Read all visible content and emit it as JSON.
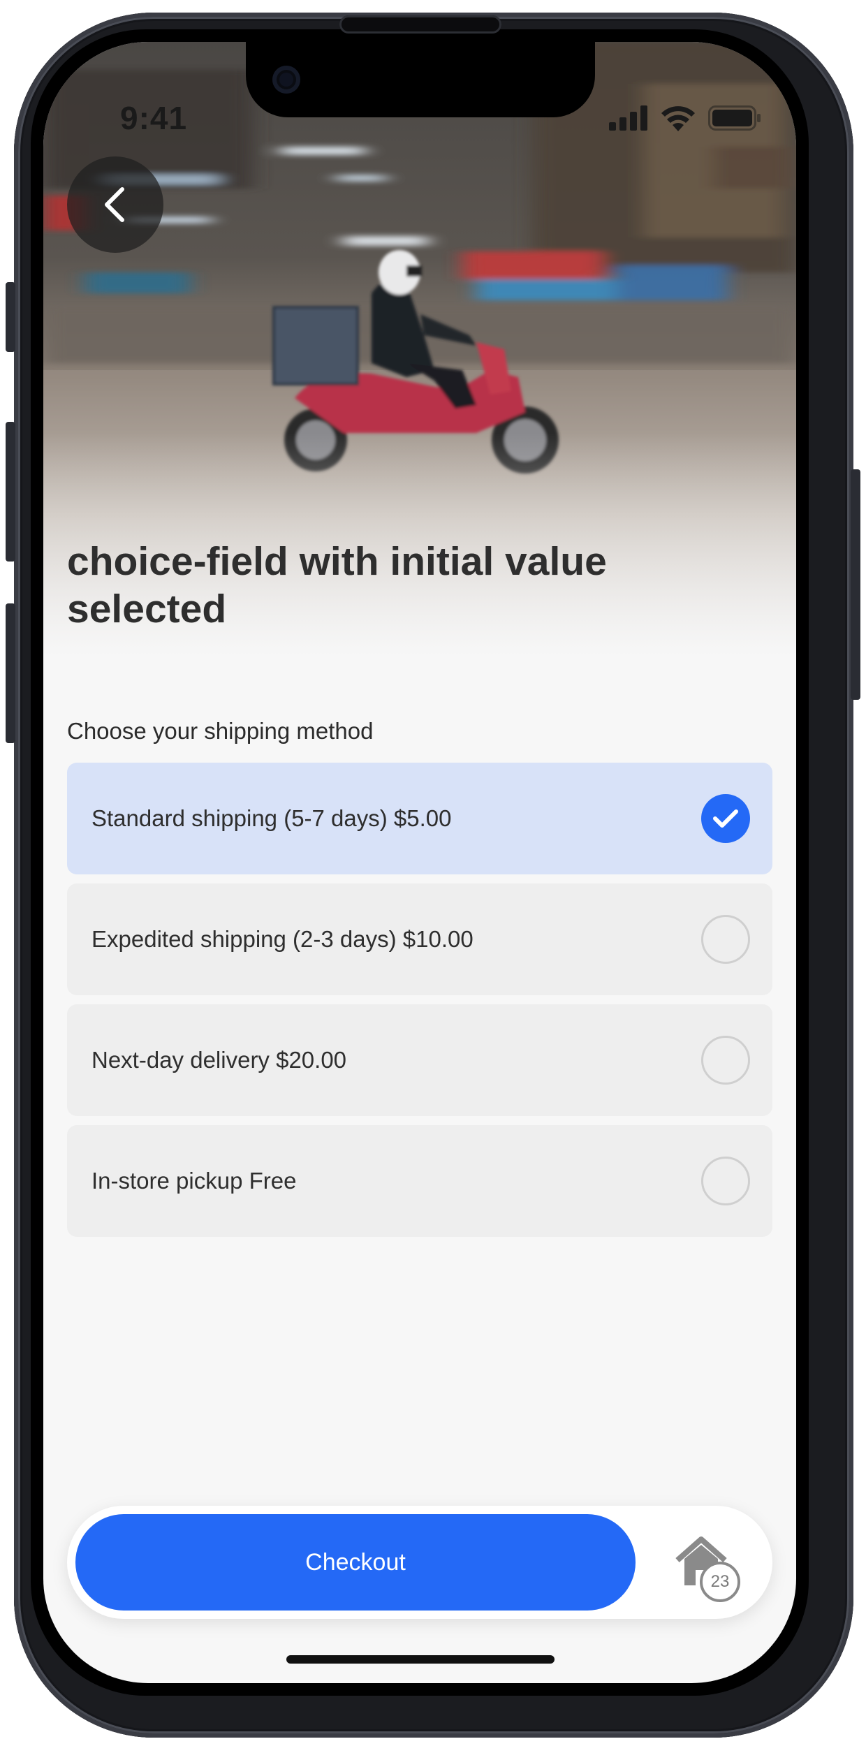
{
  "status_bar": {
    "time": "9:41",
    "icons": [
      "cellular-icon",
      "wifi-icon",
      "battery-icon"
    ]
  },
  "hero": {
    "back_icon": "chevron-left-icon",
    "image": "delivery scooter rider"
  },
  "page": {
    "title": "choice-field with initial value selected"
  },
  "choice_field": {
    "label": "Choose your shipping method",
    "selected_index": 0,
    "options": [
      {
        "label": "Standard shipping (5-7 days) $5.00",
        "selected": true
      },
      {
        "label": "Expedited shipping (2-3 days) $10.00",
        "selected": false
      },
      {
        "label": "Next-day delivery $20.00",
        "selected": false
      },
      {
        "label": "In-store pickup Free",
        "selected": false
      }
    ]
  },
  "bottom_bar": {
    "checkout_label": "Checkout",
    "home_icon": "home-icon",
    "badge_count": "23"
  },
  "colors": {
    "accent": "#2469f6",
    "selected_bg": "#d8e2f8",
    "option_bg": "#eeeeee",
    "title": "#2e2e2e"
  }
}
